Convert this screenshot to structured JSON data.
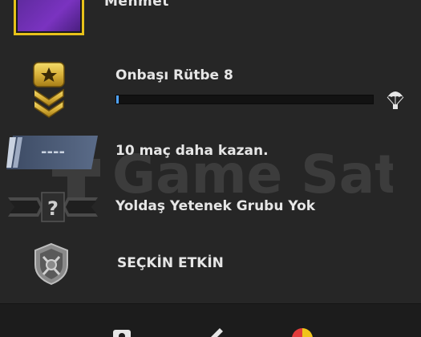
{
  "player": {
    "name": "Mehmet"
  },
  "rank": {
    "label": "Onbaşı Rütbe 8",
    "progress_fraction": 0.01
  },
  "wins": {
    "badge_text": "----",
    "label": "10 maç daha kazan."
  },
  "skill_group": {
    "badge_text": "?",
    "label": "Yoldaş Yetenek Grubu Yok"
  },
  "elite": {
    "label": "SEÇKİN ETKİN"
  },
  "watermark": {
    "text": "Game Satış"
  },
  "colors": {
    "background": "#262626",
    "accent_gold": "#e8c21a",
    "progress_blue": "#4fa3ff",
    "text": "#e6e6e6"
  },
  "icons": {
    "rank": "corporal-chevron-icon",
    "wins": "wins-plate-icon",
    "skill_group": "unknown-skill-group-icon",
    "elite": "elite-shield-icon",
    "drop": "parachute-icon",
    "footer": [
      "profile-icon",
      "edit-icon",
      "coin-icon"
    ]
  }
}
